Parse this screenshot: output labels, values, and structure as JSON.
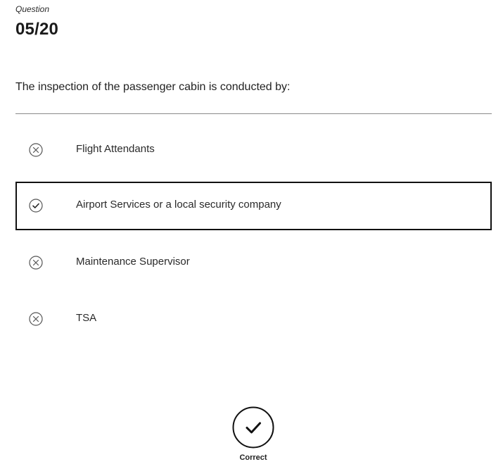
{
  "question": {
    "label": "Question",
    "number": "05/20",
    "text": "The inspection of the passenger cabin is conducted by:"
  },
  "options": [
    {
      "label": "Flight Attendants",
      "status": "incorrect",
      "icon": "x-circle-icon"
    },
    {
      "label": "Airport Services or a local security company",
      "status": "correct",
      "selected": true,
      "icon": "check-circle-icon"
    },
    {
      "label": "Maintenance Supervisor",
      "status": "incorrect",
      "icon": "x-circle-icon"
    },
    {
      "label": "TSA",
      "status": "incorrect",
      "icon": "x-circle-icon"
    }
  ],
  "result": {
    "label": "Correct",
    "icon": "check-circle-icon"
  },
  "colors": {
    "text": "#222222",
    "border": "#111111",
    "divider": "#8a8a8a",
    "icon_stroke": "#555555"
  }
}
